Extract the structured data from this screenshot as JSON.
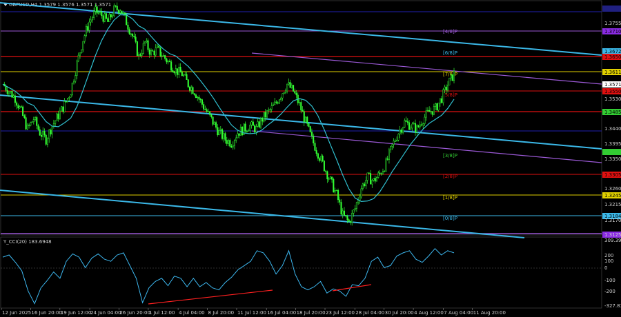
{
  "header": {
    "title": "GBPUSD,H4 1.3579 1.3576 1.3571 1.3571"
  },
  "colors": {
    "background": "#000000",
    "bull": "#33ff33",
    "bear": "#33ff33",
    "channel": "#3bb8e8",
    "ma": "#30c0d0",
    "purple": "#9b59d6",
    "red_level": "#e01010",
    "yellow_level": "#e0d000",
    "cci": "#3db8f0",
    "divergence": "#ff2020"
  },
  "price_axis": {
    "labels": [
      "1.3755",
      "1.3710",
      "1.3672",
      "1.3650",
      "1.3611",
      "1.3571",
      "1.3550",
      "1.3530",
      "1.3485",
      "1.3440",
      "1.3395",
      "1.3350",
      "1.3305",
      "1.3260",
      "1.3245",
      "1.3215",
      "1.3184",
      "1.3170",
      "1.3125"
    ],
    "levels": [
      {
        "label": "[4/8]P",
        "value": "1.3735",
        "color": "#9b59d6"
      },
      {
        "label": "[6/8]P",
        "value": "1.3672",
        "color": "#e01010"
      },
      {
        "label": "[7/8]P",
        "value": "1.3611",
        "color": "#e0d000"
      },
      {
        "label": "[5/8]P",
        "value": "1.3550",
        "color": "#e01010"
      },
      {
        "label": "[4/8]P",
        "value": "1.3485",
        "color": "#e01010"
      },
      {
        "label": "[3/8]P",
        "value": "1.3370",
        "color": "#33cc33"
      },
      {
        "label": "[2/8]P",
        "value": "1.3305",
        "color": "#e01010"
      },
      {
        "label": "[1/8]P",
        "value": "1.3245",
        "color": "#e0d000"
      },
      {
        "label": "[0/8]P",
        "value": "1.3184",
        "color": "#3bb8e8"
      }
    ],
    "current": "1.3571"
  },
  "cci": {
    "title": "Y_CCI(20) 183.6948",
    "labels": [
      "309.3969",
      "200",
      "100",
      "0",
      "-100",
      "-200",
      "-327.8320"
    ]
  },
  "time_axis": {
    "labels": [
      "12 Jun 2025",
      "16 Jun 20:00",
      "19 Jun 12:00",
      "24 Jun 04:00",
      "26 Jun 20:00",
      "1 Jul 12:00",
      "4 Jul 04:00",
      "8 Jul 20:00",
      "11 Jul 12:00",
      "16 Jul 04:00",
      "18 Jul 20:00",
      "23 Jul 12:00",
      "28 Jul 04:00",
      "30 Jul 20:00",
      "4 Aug 12:00",
      "7 Aug 04:00",
      "11 Aug 20:00"
    ]
  },
  "chart_data": {
    "type": "candlestick",
    "symbol": "GBPUSD",
    "timeframe": "H4",
    "ylim": [
      1.3125,
      1.38
    ],
    "close_series": [
      1.356,
      1.354,
      1.352,
      1.348,
      1.343,
      1.346,
      1.342,
      1.34,
      1.344,
      1.347,
      1.35,
      1.354,
      1.362,
      1.369,
      1.374,
      1.377,
      1.376,
      1.374,
      1.3775,
      1.378,
      1.374,
      1.37,
      1.364,
      1.368,
      1.365,
      1.366,
      1.364,
      1.362,
      1.36,
      1.359,
      1.356,
      1.354,
      1.351,
      1.348,
      1.345,
      1.342,
      1.34,
      1.339,
      1.342,
      1.343,
      1.344,
      1.343,
      1.346,
      1.348,
      1.35,
      1.353,
      1.356,
      1.354,
      1.35,
      1.345,
      1.34,
      1.336,
      1.332,
      1.328,
      1.324,
      1.318,
      1.316,
      1.32,
      1.326,
      1.329,
      1.328,
      1.33,
      1.333,
      1.338,
      1.342,
      1.345,
      1.344,
      1.343,
      1.346,
      1.348,
      1.349,
      1.352,
      1.356,
      1.359
    ],
    "cci_series": [
      140,
      160,
      90,
      10,
      -180,
      -300,
      -150,
      -80,
      0,
      -60,
      100,
      170,
      140,
      40,
      130,
      170,
      120,
      100,
      160,
      180,
      60,
      -60,
      -290,
      -150,
      -90,
      -60,
      -130,
      -40,
      -60,
      -140,
      -60,
      -140,
      -100,
      -150,
      -170,
      -100,
      -50,
      20,
      60,
      100,
      200,
      180,
      100,
      -20,
      60,
      200,
      -20,
      -140,
      -170,
      -140,
      -90,
      -200,
      -160,
      -180,
      -230,
      -120,
      -130,
      -60,
      100,
      140,
      40,
      60,
      150,
      180,
      200,
      120,
      90,
      150,
      220,
      160,
      200,
      180
    ],
    "divergences": [
      "rsi-bullish-1",
      "rsi-bullish-2"
    ]
  }
}
